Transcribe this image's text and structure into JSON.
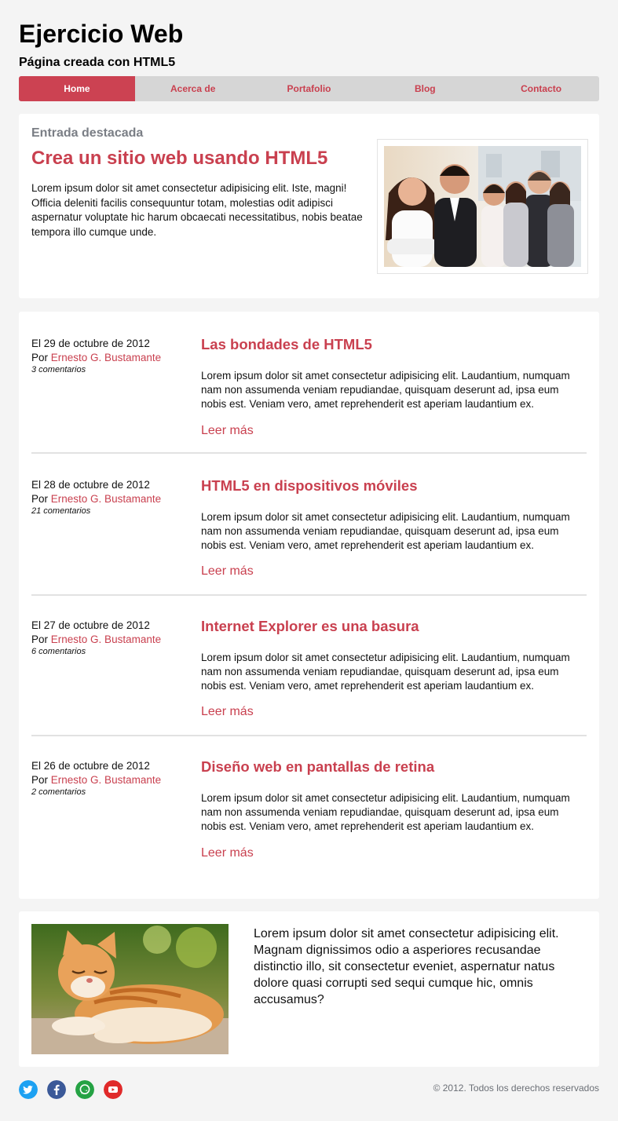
{
  "header": {
    "title": "Ejercicio Web",
    "subtitle": "Página creada con HTML5"
  },
  "nav": {
    "items": [
      {
        "label": "Home",
        "active": true
      },
      {
        "label": "Acerca de"
      },
      {
        "label": "Portafolio"
      },
      {
        "label": "Blog"
      },
      {
        "label": "Contacto"
      }
    ]
  },
  "featured": {
    "eyebrow": "Entrada destacada",
    "title": "Crea un sitio web usando HTML5",
    "text": "Lorem ipsum dolor sit amet consectetur adipisicing elit. Iste, magni! Officia deleniti facilis consequuntur totam, molestias odit adipisci aspernatur voluptate hic harum obcaecati necessitatibus, nobis beatae tempora illo cumque unde."
  },
  "posts": [
    {
      "date": "El 29 de octubre de 2012",
      "by": "Por",
      "author": "Ernesto G. Bustamante",
      "comments": "3 comentarios",
      "title": "Las bondades de HTML5",
      "text": "Lorem ipsum dolor sit amet consectetur adipisicing elit. Laudantium, numquam nam non assumenda veniam repudiandae, quisquam deserunt ad, ipsa eum nobis est. Veniam vero, amet reprehenderit est aperiam laudantium ex.",
      "more": "Leer más"
    },
    {
      "date": "El 28 de octubre de 2012",
      "by": "Por",
      "author": "Ernesto G. Bustamante",
      "comments": "21 comentarios",
      "title": "HTML5 en dispositivos móviles",
      "text": "Lorem ipsum dolor sit amet consectetur adipisicing elit. Laudantium, numquam nam non assumenda veniam repudiandae, quisquam deserunt ad, ipsa eum nobis est. Veniam vero, amet reprehenderit est aperiam laudantium ex.",
      "more": "Leer más"
    },
    {
      "date": "El 27 de octubre de 2012",
      "by": "Por",
      "author": "Ernesto G. Bustamante",
      "comments": "6 comentarios",
      "title": "Internet Explorer es una basura",
      "text": "Lorem ipsum dolor sit amet consectetur adipisicing elit. Laudantium, numquam nam non assumenda veniam repudiandae, quisquam deserunt ad, ipsa eum nobis est. Veniam vero, amet reprehenderit est aperiam laudantium ex.",
      "more": "Leer más"
    },
    {
      "date": "El 26 de octubre de 2012",
      "by": "Por",
      "author": "Ernesto G. Bustamante",
      "comments": "2 comentarios",
      "title": "Diseño web en pantallas de retina",
      "text": "Lorem ipsum dolor sit amet consectetur adipisicing elit. Laudantium, numquam nam non assumenda veniam repudiandae, quisquam deserunt ad, ipsa eum nobis est. Veniam vero, amet reprehenderit est aperiam laudantium ex.",
      "more": "Leer más"
    }
  ],
  "aside": {
    "text": "Lorem ipsum dolor sit amet consectetur adipisicing elit. Magnam dignissimos odio a asperiores recusandae distinctio illo, sit consectetur eveniet, aspernatur natus dolore quasi corrupti sed sequi cumque hic, omnis accusamus?"
  },
  "footer": {
    "social": [
      "twitter-icon",
      "facebook-icon",
      "whatsapp-icon",
      "youtube-icon"
    ],
    "copyright": "© 2012. Todos los derechos reservados"
  },
  "colors": {
    "accent": "#c9404f",
    "nav_bg": "#d6d6d6",
    "page_bg": "#f4f4f4"
  }
}
